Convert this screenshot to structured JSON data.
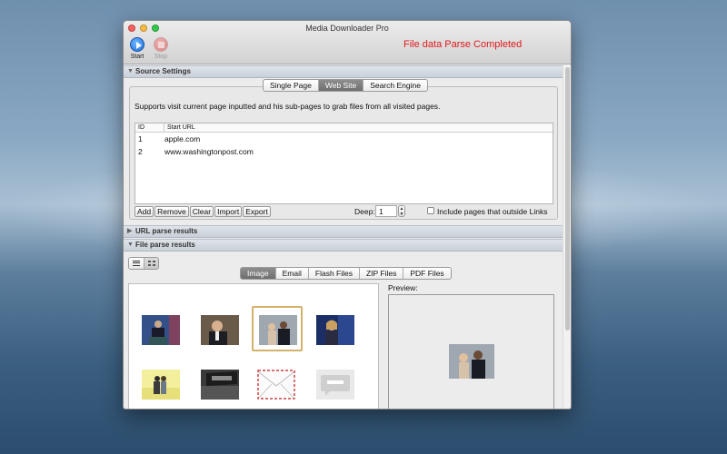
{
  "window": {
    "title": "Media Downloader Pro",
    "status_message": "File data Parse Completed"
  },
  "toolbar": {
    "start_label": "Start",
    "stop_label": "Stop"
  },
  "source_settings": {
    "section_title": "Source Settings",
    "tabs": [
      "Single Page",
      "Web Site",
      "Search Engine"
    ],
    "active_tab": "Web Site",
    "description": "Supports visit current page inputted and his sub-pages to grab files from all visited pages.",
    "table": {
      "columns": [
        "ID",
        "Start URL"
      ],
      "rows": [
        {
          "id": "1",
          "url": "apple.com"
        },
        {
          "id": "2",
          "url": "www.washingtonpost.com"
        }
      ]
    },
    "buttons": [
      "Add",
      "Remove",
      "Clear",
      "Import",
      "Export"
    ],
    "deep_label": "Deep:",
    "deep_value": "1",
    "include_outside_label": "Include pages that outside Links",
    "include_outside_checked": false
  },
  "url_parse": {
    "section_title": "URL parse results"
  },
  "file_parse": {
    "section_title": "File parse results",
    "tabs": [
      "Image",
      "Email",
      "Flash Files",
      "ZIP Files",
      "PDF Files"
    ],
    "active_tab": "Image",
    "preview_label": "Preview:",
    "thumbnails": [
      {
        "name": "thumb-podium-speaker",
        "selected": false
      },
      {
        "name": "thumb-man-portrait",
        "selected": false
      },
      {
        "name": "thumb-couple-photo",
        "selected": true
      },
      {
        "name": "thumb-woman-speaking",
        "selected": false
      },
      {
        "name": "thumb-couple-yellow",
        "selected": false
      },
      {
        "name": "thumb-washington-post-logo",
        "selected": false
      },
      {
        "name": "thumb-envelope",
        "selected": false
      },
      {
        "name": "thumb-op-ed",
        "selected": false
      }
    ]
  }
}
